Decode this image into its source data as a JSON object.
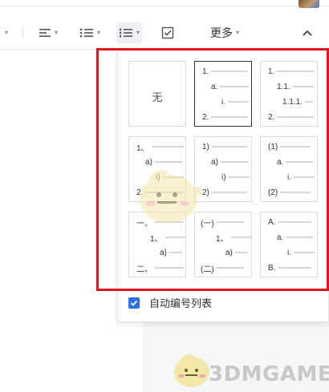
{
  "toolbar": {
    "more_label": "更多",
    "icons": [
      "align-icon",
      "bullet-list-icon",
      "numbered-list-icon",
      "checklist-icon",
      "collapse-icon"
    ]
  },
  "list_dropdown": {
    "none_label": "无",
    "styles": [
      {
        "name": "none"
      },
      {
        "name": "numeric-plain",
        "markers": [
          "1.",
          "a.",
          "i.",
          "2."
        ]
      },
      {
        "name": "numeric-multilevel",
        "markers": [
          "1.",
          "1.1.",
          "1.1.1.",
          "2."
        ]
      },
      {
        "name": "chinese-comma",
        "markers": [
          "1、",
          "a)",
          "i)",
          "2."
        ]
      },
      {
        "name": "paren-right",
        "markers": [
          "1)",
          "a)",
          "i)",
          "2)"
        ]
      },
      {
        "name": "paren-both",
        "markers": [
          "(1)",
          "a.",
          "i.",
          "(2)"
        ]
      },
      {
        "name": "chinese-numeral",
        "markers": [
          "一、",
          "1、",
          "a)",
          "二、"
        ]
      },
      {
        "name": "chinese-paren",
        "markers": [
          "(一)",
          "1、",
          "a)",
          "(二)"
        ]
      },
      {
        "name": "alpha-upper",
        "markers": [
          "A.",
          "a.",
          "i.",
          "B."
        ]
      }
    ],
    "selected_index": 1,
    "auto_number_label": "自动编号列表",
    "auto_number_checked": true
  },
  "watermark": {
    "text": "3DMGAME"
  },
  "colors": {
    "accent": "#2f6fec",
    "highlight_frame": "#e0151b"
  }
}
